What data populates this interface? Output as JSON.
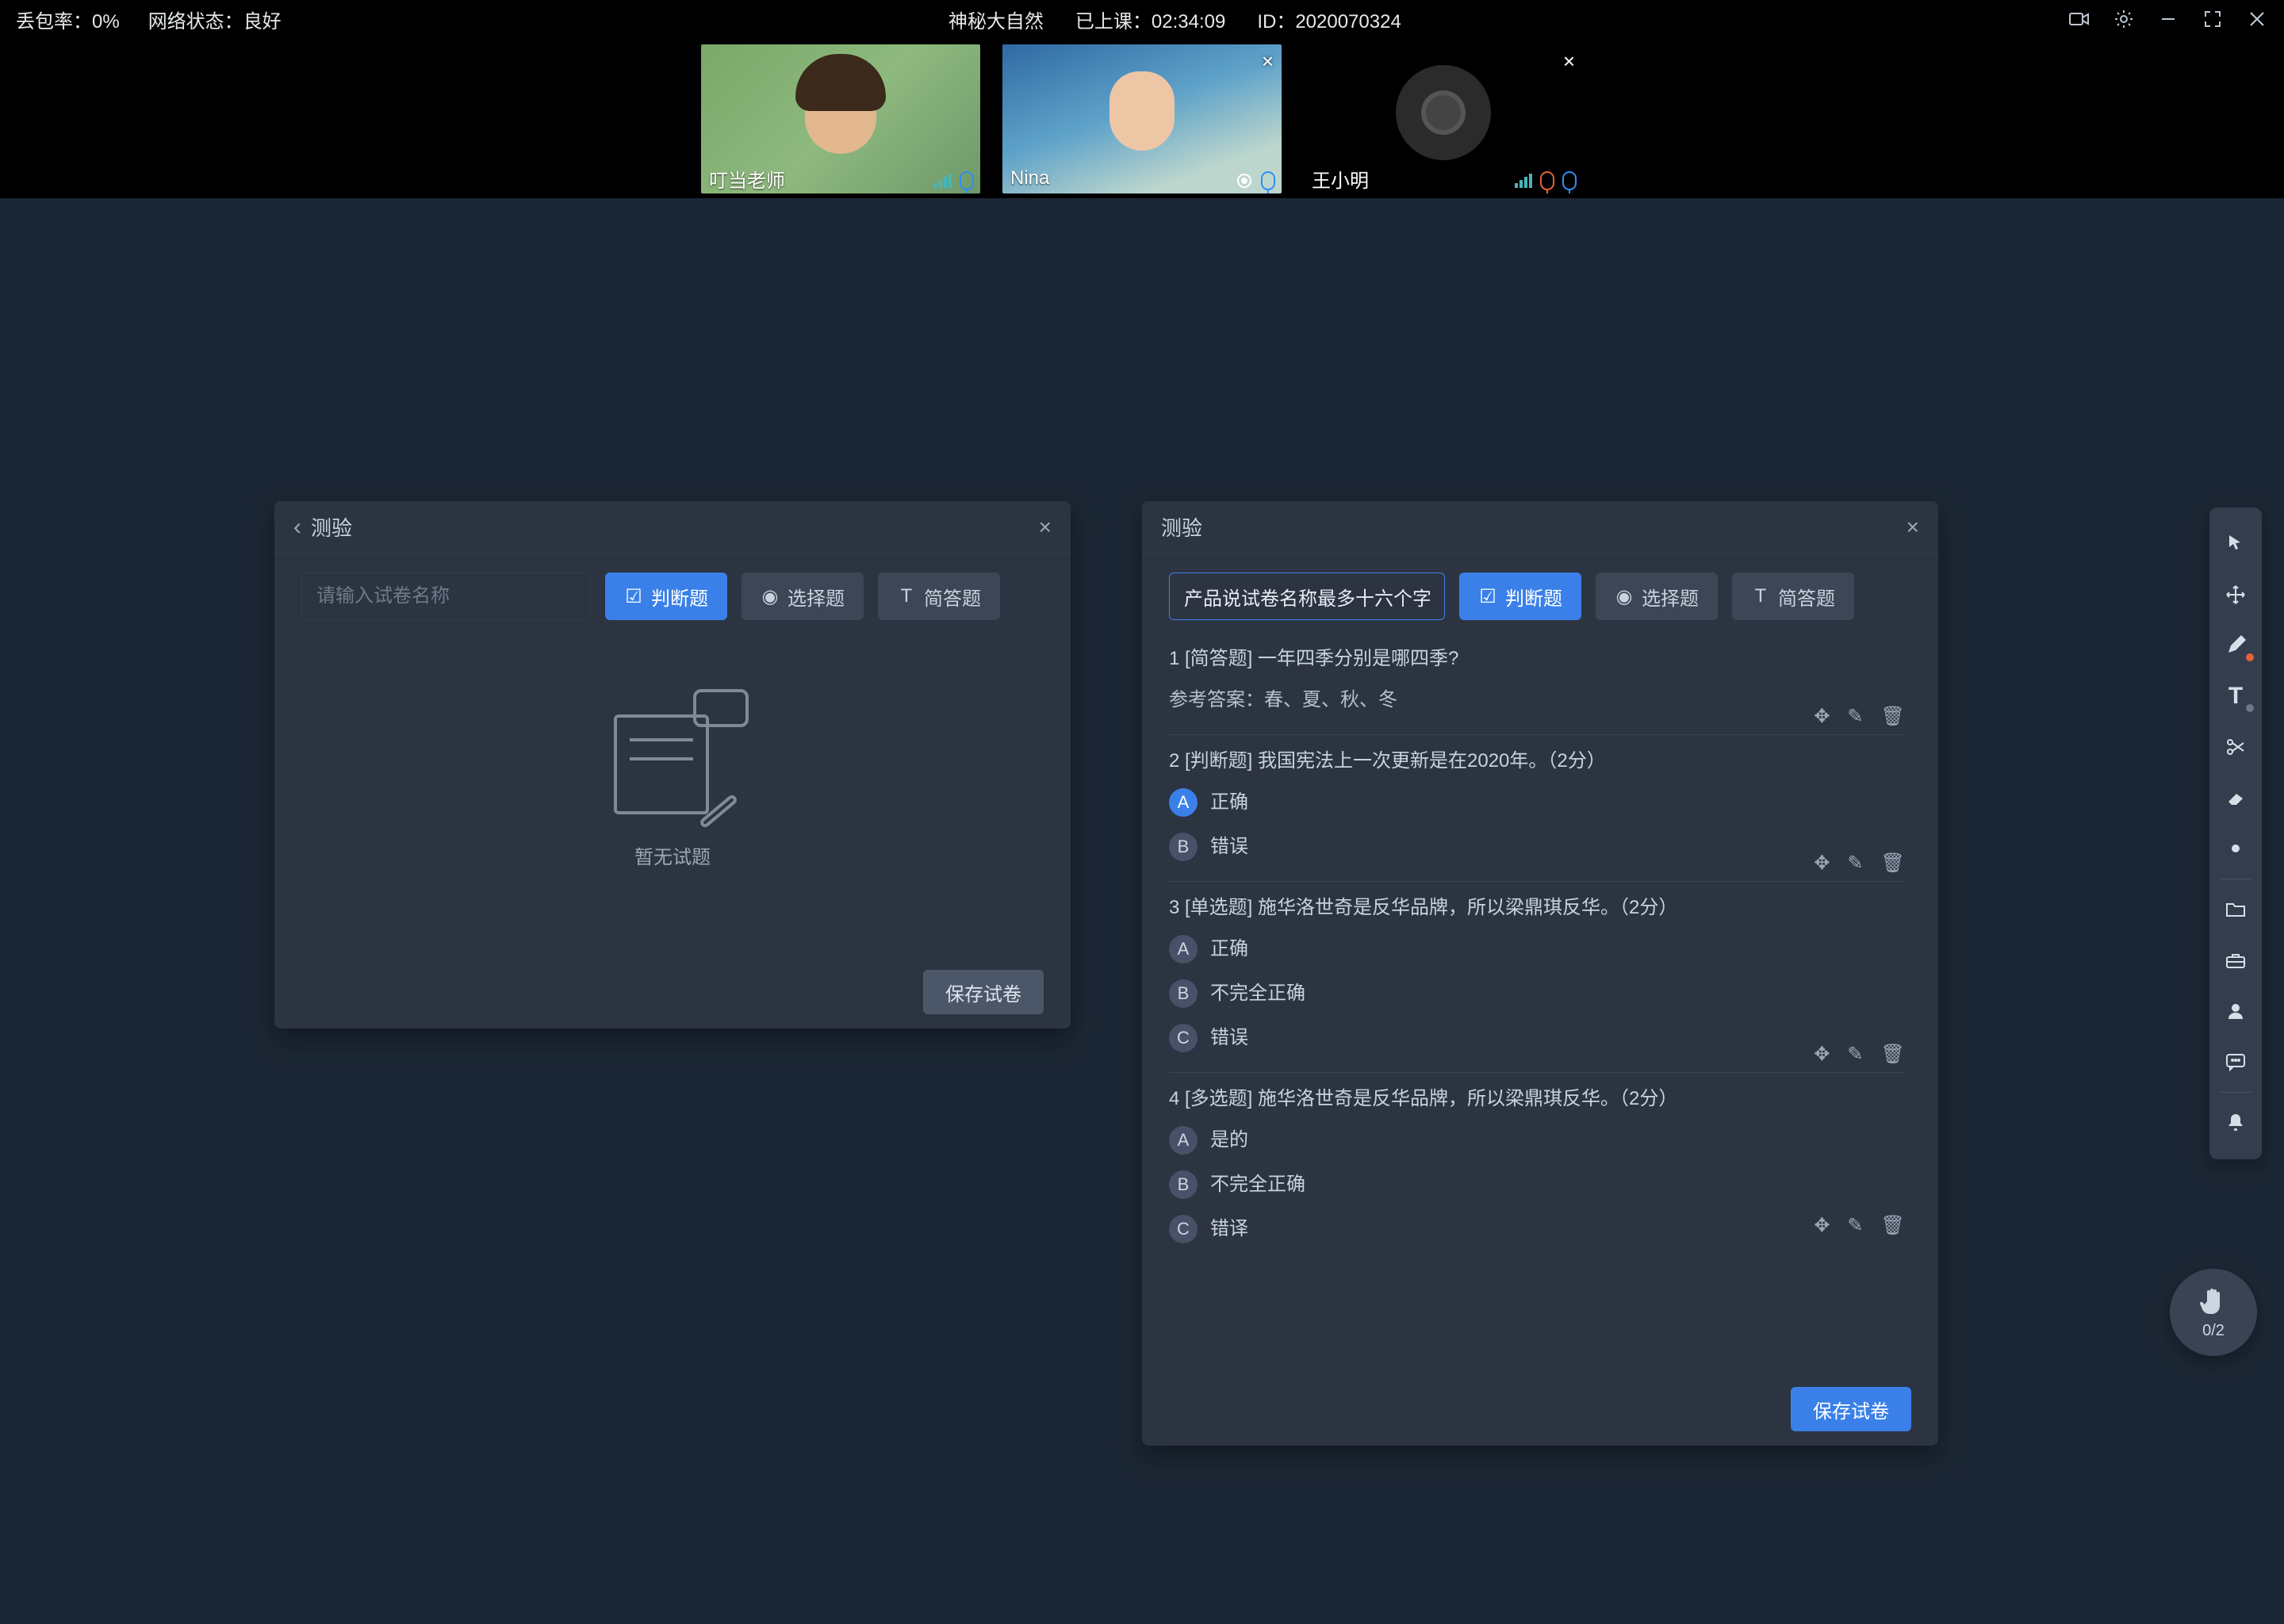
{
  "topbar": {
    "loss_label": "丢包率：",
    "loss_value": "0%",
    "net_label": "网络状态：",
    "net_value": "良好",
    "course": "神秘大自然",
    "elapsed_label": "已上课：",
    "elapsed_value": "02:34:09",
    "id_label": "ID：",
    "id_value": "2020070324"
  },
  "video": {
    "t0": {
      "name": "叮当老师"
    },
    "t1": {
      "name": "Nina"
    },
    "t2": {
      "name": "王小明"
    }
  },
  "panel_empty": {
    "title": "测验",
    "input_placeholder": "请输入试卷名称",
    "btn_judge": "判断题",
    "btn_choice": "选择题",
    "btn_short": "简答题",
    "empty_text": "暂无试题",
    "save": "保存试卷"
  },
  "panel_full": {
    "title": "测验",
    "input_value": "产品说试卷名称最多十六个字",
    "btn_judge": "判断题",
    "btn_choice": "选择题",
    "btn_short": "简答题",
    "save": "保存试卷",
    "q1": {
      "title": "1 [简答题] 一年四季分别是哪四季?",
      "answer": "参考答案：春、夏、秋、冬"
    },
    "q2": {
      "title": "2 [判断题] 我国宪法上一次更新是在2020年。（2分）",
      "a": "正确",
      "b": "错误"
    },
    "q3": {
      "title": "3 [单选题] 施华洛世奇是反华品牌，所以梁鼎琪反华。（2分）",
      "a": "正确",
      "b": "不完全正确",
      "c": "错误"
    },
    "q4": {
      "title": "4 [多选题] 施华洛世奇是反华品牌，所以梁鼎琪反华。（2分）",
      "a": "是的",
      "b": "不完全正确",
      "c": "错译"
    }
  },
  "hand": {
    "count": "0/2"
  }
}
